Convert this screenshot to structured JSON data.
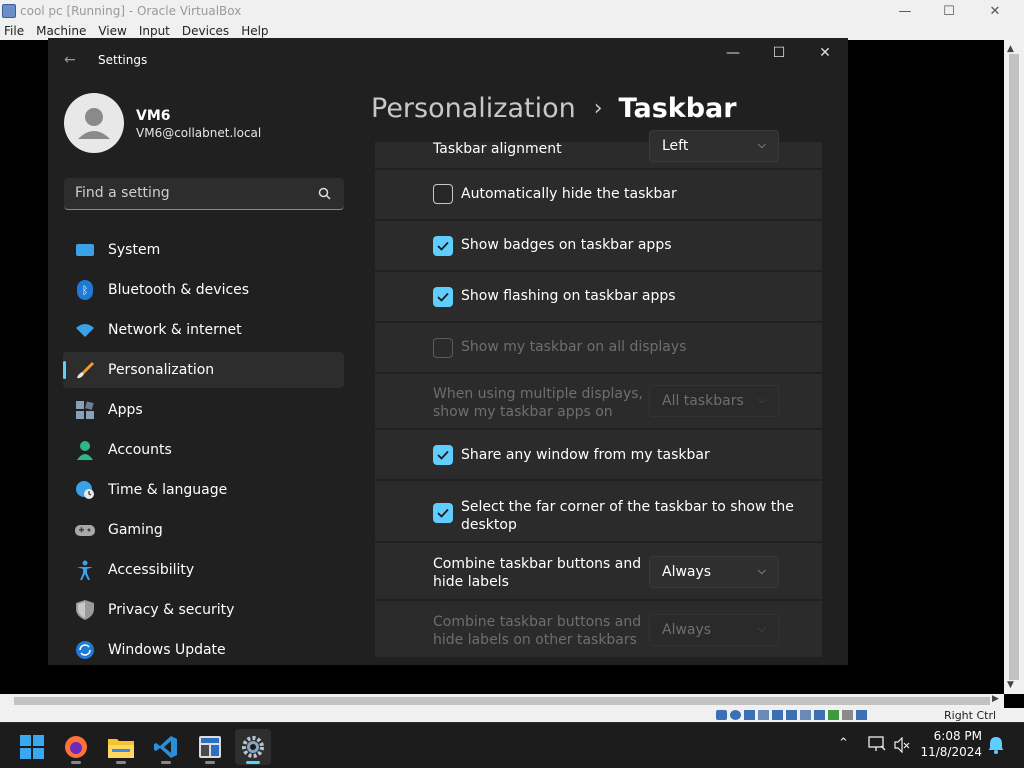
{
  "vbox": {
    "title": "cool pc [Running] - Oracle VirtualBox",
    "menu": [
      "File",
      "Machine",
      "View",
      "Input",
      "Devices",
      "Help"
    ],
    "status_hotkey": "Right Ctrl"
  },
  "settings": {
    "app_title": "Settings",
    "user": {
      "name": "VM6",
      "email": "VM6@collabnet.local"
    },
    "search_placeholder": "Find a setting",
    "nav": [
      {
        "label": "System",
        "icon": "system-icon"
      },
      {
        "label": "Bluetooth & devices",
        "icon": "bluetooth-icon"
      },
      {
        "label": "Network & internet",
        "icon": "wifi-icon"
      },
      {
        "label": "Personalization",
        "icon": "brush-icon",
        "active": true
      },
      {
        "label": "Apps",
        "icon": "apps-icon"
      },
      {
        "label": "Accounts",
        "icon": "accounts-icon"
      },
      {
        "label": "Time & language",
        "icon": "clock-globe-icon"
      },
      {
        "label": "Gaming",
        "icon": "gamepad-icon"
      },
      {
        "label": "Accessibility",
        "icon": "accessibility-icon"
      },
      {
        "label": "Privacy & security",
        "icon": "shield-icon"
      },
      {
        "label": "Windows Update",
        "icon": "update-icon"
      }
    ],
    "breadcrumb": {
      "parent": "Personalization",
      "separator": "›",
      "current": "Taskbar"
    },
    "rows": {
      "alignment": {
        "label": "Taskbar alignment",
        "value": "Left"
      },
      "auto_hide": {
        "label": "Automatically hide the taskbar",
        "checked": false
      },
      "badges": {
        "label": "Show badges on taskbar apps",
        "checked": true
      },
      "flashing": {
        "label": "Show flashing on taskbar apps",
        "checked": true
      },
      "all_displays": {
        "label": "Show my taskbar on all displays",
        "checked": false,
        "disabled": true
      },
      "multi_display": {
        "label_line1": "When using multiple displays,",
        "label_line2": "show my taskbar apps on",
        "value": "All taskbars",
        "disabled": true
      },
      "share_window": {
        "label": "Share any window from my taskbar",
        "checked": true
      },
      "far_corner": {
        "label_line1": "Select the far corner of the taskbar to show the",
        "label_line2": "desktop",
        "checked": true
      },
      "combine": {
        "label_line1": "Combine taskbar buttons and",
        "label_line2": "hide labels",
        "value": "Always"
      },
      "combine_other": {
        "label_line1": "Combine taskbar buttons and",
        "label_line2": "hide labels on other taskbars",
        "value": "Always",
        "disabled": true
      }
    }
  },
  "taskbar": {
    "apps": [
      "windows-start-icon",
      "firefox-icon",
      "file-explorer-icon",
      "vscode-icon",
      "calculator-icon",
      "settings-gear-icon"
    ],
    "time": "6:08 PM",
    "date": "11/8/2024"
  },
  "colors": {
    "accent": "#60cdff",
    "window_bg": "#202020",
    "card_bg": "#2b2b2b"
  }
}
